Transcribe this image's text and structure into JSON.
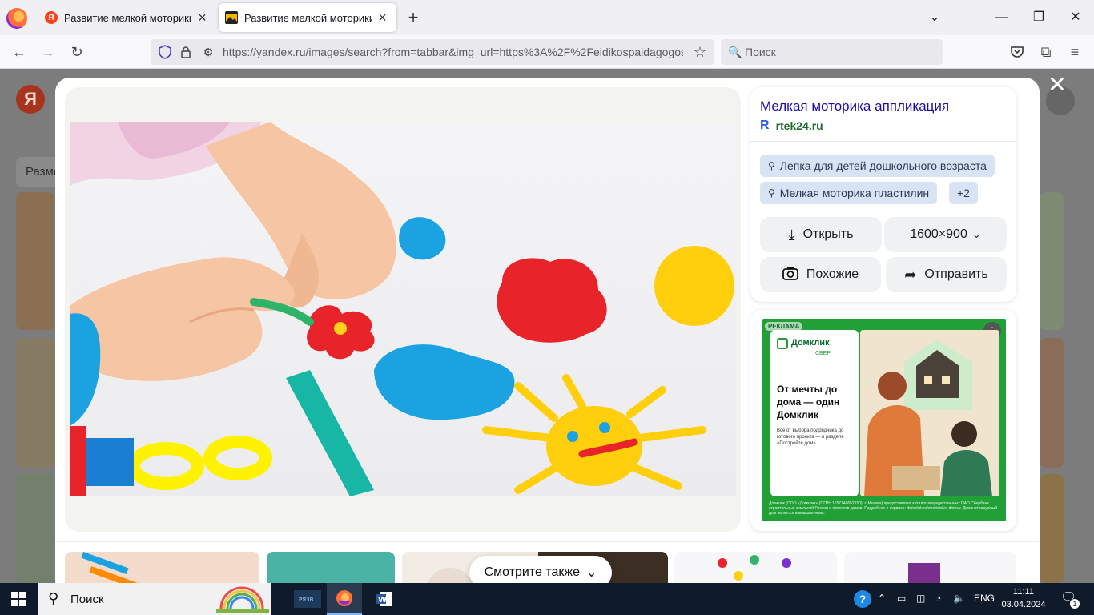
{
  "browser": {
    "tabs": [
      {
        "title": "Развитие мелкой моторики у детей",
        "favicon": "yandex-favicon",
        "active": false
      },
      {
        "title": "Развитие мелкой моторики у детей",
        "favicon": "image-favicon",
        "active": true
      }
    ],
    "url": "https://yandex.ru/images/search?from=tabbar&img_url=https%3A%2F%2Feidikospaidagogos.gr",
    "search_placeholder": "Поиск"
  },
  "background": {
    "logo": "Я",
    "pill_label": "Разме"
  },
  "viewer": {
    "title": "Мелкая моторика аппликация",
    "source": "rtek24.ru",
    "source_icon": "R",
    "tags": [
      "Лепка для детей дошкольного возраста",
      "Мелкая моторика пластилин"
    ],
    "more_tags": "+2",
    "open_label": "Открыть",
    "size_label": "1600×900",
    "similar_label": "Похожие",
    "share_label": "Отправить",
    "close_icon": "close-icon"
  },
  "ad": {
    "label": "РЕКЛАМА",
    "brand": "Домклик",
    "brand_sub": "СБЕР",
    "headline": "От мечты до дома — один Домклик",
    "body": "Всё от выбора подрядчика до готового проекта — в разделе «Постройте дом»",
    "legal": "Домклик (ООО «Домклик» (ОГРН 1157746652150), г. Москва) предоставляет каталог аккредитованных ПАО Сбербанк строительных компаний России и проектов домов. Подробнее о сервисе: domclick.ru/stroitelstvo-domov. Демонстрируемый дом является вымышленным."
  },
  "see_also": "Смотрите также",
  "taskbar": {
    "search_label": "Поиск",
    "lang": "ENG",
    "time": "11:11",
    "date": "03.04.2024",
    "notifications": "1"
  },
  "colors": {
    "accent_link": "#1a0dab",
    "source_green": "#1f6b2b",
    "ad_green": "#21a038",
    "taskbar": "#0f1a2b"
  }
}
